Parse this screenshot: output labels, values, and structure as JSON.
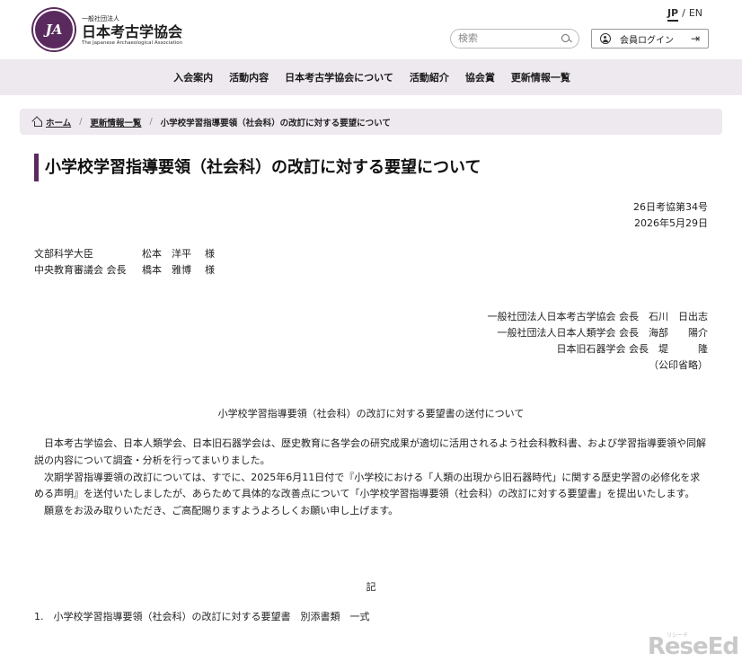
{
  "header": {
    "logo_mark": "JA",
    "logo_sub": "一般社団法人",
    "logo_name": "日本考古学協会",
    "logo_en": "The Japanese Archaeological Association",
    "lang_jp": "JP",
    "lang_sep": "/",
    "lang_en": "EN",
    "search_placeholder": "検索",
    "login_label": "会員ログイン",
    "login_icon": "⇥"
  },
  "nav": {
    "items": [
      "入会案内",
      "活動内容",
      "日本考古学協会について",
      "活動紹介",
      "協会賞",
      "更新情報一覧"
    ]
  },
  "breadcrumb": {
    "home": "ホーム",
    "sep": "/",
    "parent": "更新情報一覧",
    "current": "小学校学習指導要領（社会科）の改訂に対する要望について"
  },
  "page": {
    "title": "小学校学習指導要領（社会科）の改訂に対する要望について",
    "doc_number": "26日考協第34号",
    "doc_date": "2026年5月29日",
    "recipients": [
      {
        "org": "文部科学大臣",
        "name": "松本　洋平",
        "honorific": "様"
      },
      {
        "org": "中央教育審議会 会長",
        "name": "橋本　雅博",
        "honorific": "様"
      }
    ],
    "senders": [
      "一般社団法人日本考古学協会 会長　石川　日出志",
      "一般社団法人日本人類学会 会長　海部　　陽介",
      "日本旧石器学会 会長　堤　　　隆",
      "（公印省略）"
    ],
    "subject": "小学校学習指導要領（社会科）の改訂に対する要望書の送付について",
    "paragraphs": [
      "日本考古学協会、日本人類学会、日本旧石器学会は、歴史教育に各学会の研究成果が適切に活用されるよう社会科教科書、および学習指導要領や同解説の内容について調査・分析を行ってまいりました。",
      "次期学習指導要領の改訂については、すでに、2025年6月11日付で『小学校における「人類の出現から旧石器時代」に関する歴史学習の必修化を求める声明』を送付いたしましたが、あらためて具体的な改善点について「小学校学習指導要領（社会科）の改訂に対する要望書」を提出いたします。",
      "願意をお汲み取りいただき、ご高配賜りますようよろしくお願い申し上げます。"
    ],
    "ki": "記",
    "enclosure": "1.　小学校学習指導要領（社会科）の改訂に対する要望書　別添書類　一式"
  },
  "watermark": {
    "brand": "ReseEd",
    "small": "リシード"
  },
  "colors": {
    "accent": "#5a2a5e",
    "band": "#eee8ef"
  }
}
